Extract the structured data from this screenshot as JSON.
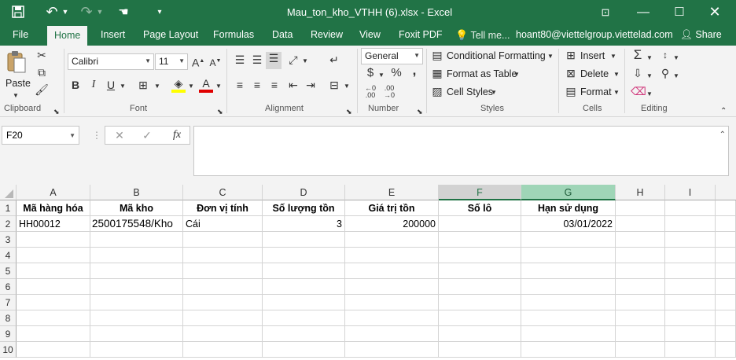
{
  "window": {
    "title": "Mau_ton_kho_VTHH (6).xlsx - Excel",
    "quick_access": {
      "save_icon": "save-icon",
      "undo_icon": "undo-icon",
      "redo_icon": "redo-icon",
      "touch_icon": "touch-mode-icon",
      "customize_icon": "customize-qat-icon"
    },
    "controls": {
      "ribbon_display": "ribbon-display-icon",
      "minimize": "minimize-icon",
      "maximize": "maximize-icon",
      "close": "close-icon"
    }
  },
  "tabs": [
    "File",
    "Home",
    "Insert",
    "Page Layout",
    "Formulas",
    "Data",
    "Review",
    "View",
    "Foxit PDF"
  ],
  "active_tab": "Home",
  "tell_me": "Tell me...",
  "account": "hoant80@viettelgroup.viettelad.com",
  "share": "Share",
  "ribbon": {
    "clipboard": {
      "label": "Clipboard",
      "paste": "Paste"
    },
    "font": {
      "label": "Font",
      "font_name": "Calibri",
      "font_size": "11"
    },
    "alignment": {
      "label": "Alignment"
    },
    "number": {
      "label": "Number",
      "format": "General",
      "currency": "$",
      "percent": "%",
      "comma": ","
    },
    "styles": {
      "label": "Styles",
      "conditional": "Conditional Formatting",
      "format_table": "Format as Table",
      "cell_styles": "Cell Styles"
    },
    "cells": {
      "label": "Cells",
      "insert": "Insert",
      "delete": "Delete",
      "format": "Format"
    },
    "editing": {
      "label": "Editing"
    }
  },
  "formula_bar": {
    "name_box": "F20",
    "formula": "",
    "fx": "fx"
  },
  "sheet": {
    "columns": [
      "A",
      "B",
      "C",
      "D",
      "E",
      "F",
      "G",
      "H",
      "I"
    ],
    "selected_column": "F",
    "highlighted_column": "G",
    "rows": [
      "1",
      "2",
      "3",
      "4",
      "5",
      "6",
      "7",
      "8",
      "9",
      "10"
    ],
    "headers": [
      "Mã hàng hóa",
      "Mã kho",
      "Đơn vị tính",
      "Số lượng tồn",
      "Giá trị tồn",
      "Số lô",
      "Hạn sử dụng"
    ],
    "row2": [
      "HH00012",
      "2500175548/Kho",
      "Cái",
      "3",
      "200000",
      "",
      "03/01/2022"
    ]
  }
}
